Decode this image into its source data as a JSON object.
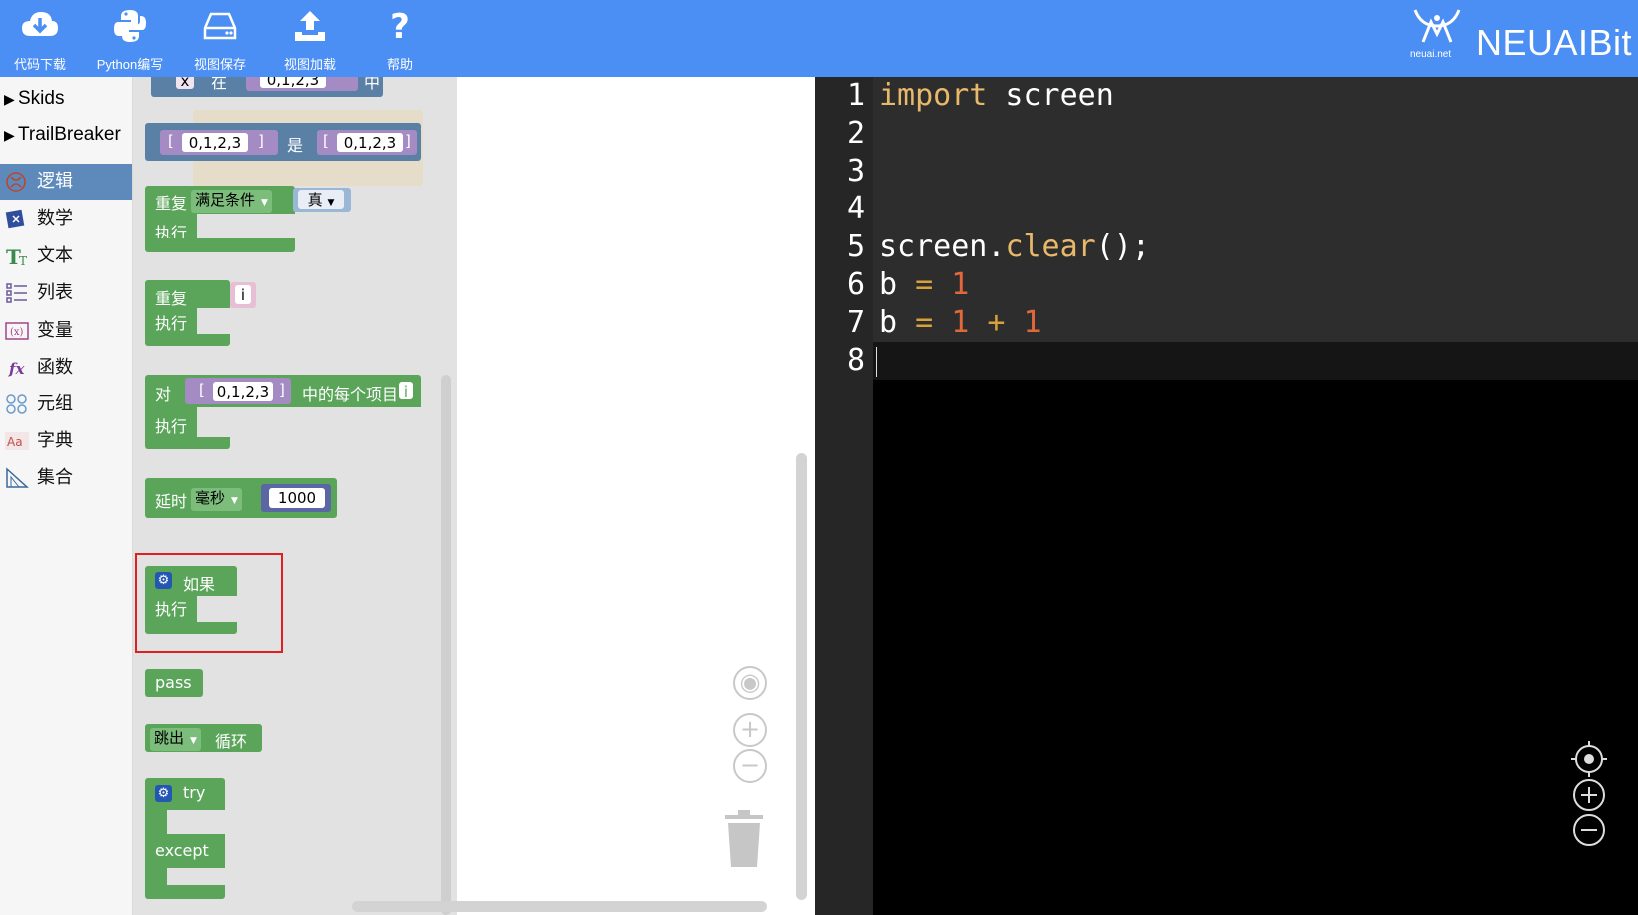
{
  "toolbar": {
    "buttons": [
      {
        "label": "代码下载",
        "icon": "cloud-download-icon"
      },
      {
        "label": "Python编写",
        "icon": "python-icon"
      },
      {
        "label": "视图保存",
        "icon": "hard-drive-icon"
      },
      {
        "label": "视图加载",
        "icon": "upload-icon"
      },
      {
        "label": "帮助",
        "icon": "help-icon"
      }
    ],
    "brand_name": "NEUAIBit",
    "brand_site": "neuai.net",
    "bg_color": "#4b8ef4"
  },
  "sidebar": {
    "trees": [
      "Skids",
      "TrailBreaker"
    ],
    "categories": [
      {
        "label": "逻辑",
        "icon": "logic-icon",
        "active": true
      },
      {
        "label": "数学",
        "icon": "math-icon"
      },
      {
        "label": "文本",
        "icon": "text-icon"
      },
      {
        "label": "列表",
        "icon": "list-icon"
      },
      {
        "label": "变量",
        "icon": "variable-icon"
      },
      {
        "label": "函数",
        "icon": "function-icon"
      },
      {
        "label": "元组",
        "icon": "tuple-icon"
      },
      {
        "label": "字典",
        "icon": "dictionary-icon"
      },
      {
        "label": "集合",
        "icon": "set-icon"
      }
    ]
  },
  "blocks": {
    "top_partial": {
      "x": "x",
      "in": "在",
      "list": "0,1,2,3",
      "mid": "中"
    },
    "compare": {
      "left": "0,1,2,3",
      "op": "是",
      "right": "0,1,2,3"
    },
    "repeat_while": {
      "label": "重复",
      "mode": "满足条件",
      "cond": "真",
      "do": "执行"
    },
    "repeat_n": {
      "label": "重复",
      "var": "i",
      "do": "执行"
    },
    "for_each": {
      "label": "对",
      "list": "0,1,2,3",
      "text": "中的每个项目",
      "var": "i",
      "do": "执行"
    },
    "delay": {
      "label": "延时",
      "unit": "毫秒",
      "value": "1000"
    },
    "if_block": {
      "label": "如果",
      "do": "执行"
    },
    "pass_block": {
      "label": "pass"
    },
    "break_block": {
      "mode": "跳出",
      "label": "循环"
    },
    "try_block": {
      "try": "try",
      "except": "except"
    }
  },
  "editor": {
    "line_numbers": [
      "1",
      "2",
      "3",
      "4",
      "5",
      "6",
      "7",
      "8"
    ],
    "lines": [
      {
        "kw": "import",
        "rest": " screen"
      },
      {},
      {},
      {},
      {
        "obj": "screen.",
        "fn": "clear",
        "tail": "();"
      },
      {
        "var": "b",
        "op": " = ",
        "num": "1"
      },
      {
        "var": "b",
        "op": " = ",
        "num1": "1",
        "op2": " + ",
        "num2": "1"
      },
      {}
    ]
  }
}
